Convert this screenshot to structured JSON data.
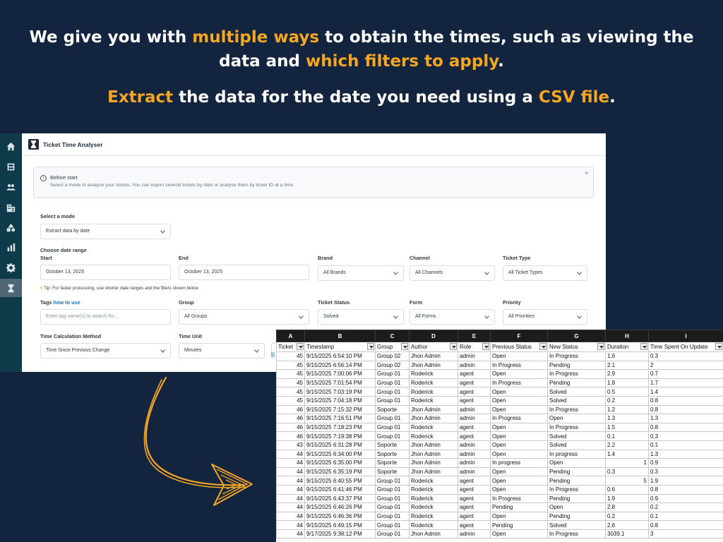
{
  "headline": {
    "line1_a": "We give you with ",
    "line1_hl": "multiple ways",
    "line1_b": " to obtain the times, such as viewing the",
    "line2_a": "data and ",
    "line2_hl": "which filters to apply",
    "line2_b": ".",
    "line3_hl": "Extract",
    "line3_a": " the data for the date you need using a ",
    "line3_hl2": "CSV file",
    "line3_b": "."
  },
  "colors": {
    "background": "#13243f",
    "accent": "#f5a623",
    "sidebar": "#0f3a4a",
    "link": "#1f73b7"
  },
  "sidebar": {
    "items": [
      {
        "icon": "home-icon"
      },
      {
        "icon": "inbox-icon"
      },
      {
        "icon": "users-icon"
      },
      {
        "icon": "building-icon"
      },
      {
        "icon": "shapes-icon"
      },
      {
        "icon": "bar-chart-icon"
      },
      {
        "icon": "gear-icon"
      },
      {
        "icon": "hourglass-icon",
        "active": true
      }
    ]
  },
  "app": {
    "title": "Ticket Time Analyser",
    "info": {
      "title": "Before start",
      "text": "Select a mode to analyse your tickets. You can export several tickets by date or analyse them by ticket ID at a time.",
      "close": "×"
    },
    "mode": {
      "label": "Select a mode",
      "value": "Extract data by date"
    },
    "date_range_label": "Choose date range",
    "start": {
      "label": "Start",
      "value": "October 13, 2025"
    },
    "end": {
      "label": "End",
      "value": "October 13, 2025"
    },
    "brand": {
      "label": "Brand",
      "value": "All Brands"
    },
    "channel": {
      "label": "Channel",
      "value": "All Channels"
    },
    "ticket_type": {
      "label": "Ticket Type",
      "value": "All Ticket Types"
    },
    "tip": "Tip: For faster processing, use shorter date ranges and the filters shown below",
    "tags": {
      "label": "Tags",
      "link": "how to use",
      "placeholder": "Enter tag name(s) to search for..."
    },
    "group": {
      "label": "Group",
      "value": "All Groups"
    },
    "ticket_status": {
      "label": "Ticket Status",
      "value": "Solved"
    },
    "form": {
      "label": "Form",
      "value": "All Forms"
    },
    "priority": {
      "label": "Priority",
      "value": "All Priorities"
    },
    "time_calc": {
      "label": "Time Calculation Method",
      "value": "Time Since Previous Change"
    },
    "time_unit": {
      "label": "Time Unit",
      "value": "Minutes"
    },
    "cut_link": "w"
  },
  "sheet": {
    "columns": [
      "A",
      "B",
      "C",
      "D",
      "E",
      "F",
      "G",
      "H",
      "I"
    ],
    "fields": [
      "Ticket",
      "Timestamp",
      "Group",
      "Author",
      "Role",
      "Previous Status",
      "New Status",
      "Duration",
      "Time Spent On Update"
    ],
    "rows": [
      [
        "45",
        "9/15/2025 6:54:10 PM",
        "Group 02",
        "Jhon Admin",
        "admin",
        "Open",
        "In Progress",
        "1.6",
        "0.3"
      ],
      [
        "45",
        "9/15/2025 6:56:14 PM",
        "Group 02",
        "Jhon Admin",
        "admin",
        "In Progress",
        "Pending",
        "2.1",
        "2"
      ],
      [
        "45",
        "9/15/2025 7:00:06 PM",
        "Group 01",
        "Roderick",
        "agent",
        "Open",
        "In Progress",
        "2.9",
        "0.7"
      ],
      [
        "45",
        "9/15/2025 7:01:54 PM",
        "Group 01",
        "Roderick",
        "agent",
        "In Progress",
        "Pending",
        "1.8",
        "1.7"
      ],
      [
        "45",
        "9/15/2025 7:03:19 PM",
        "Group 01",
        "Roderick",
        "agent",
        "Open",
        "Solved",
        "0.5",
        "1.4"
      ],
      [
        "45",
        "9/15/2025 7:04:18 PM",
        "Group 01",
        "Roderick",
        "agent",
        "Open",
        "Solved",
        "0.2",
        "0.8"
      ],
      [
        "46",
        "9/15/2025 7:15:32 PM",
        "Soporte",
        "Jhon Admin",
        "admin",
        "Open",
        "In Progress",
        "1.2",
        "0.8"
      ],
      [
        "46",
        "9/15/2025 7:16:51 PM",
        "Group 01",
        "Jhon Admin",
        "admin",
        "In Progress",
        "Open",
        "1.3",
        "1.3"
      ],
      [
        "46",
        "9/15/2025 7:18:23 PM",
        "Group 01",
        "Roderick",
        "agent",
        "Open",
        "In Progress",
        "1.5",
        "0.8"
      ],
      [
        "46",
        "9/15/2025 7:19:38 PM",
        "Group 01",
        "Roderick",
        "agent",
        "Open",
        "Solved",
        "0.1",
        "0.3"
      ],
      [
        "43",
        "9/15/2025 6:31:28 PM",
        "Soporte",
        "Jhon Admin",
        "admin",
        "Open",
        "Solved",
        "2.2",
        "0.1"
      ],
      [
        "44",
        "9/15/2025 6:34:00 PM",
        "Soporte",
        "Jhon Admin",
        "admin",
        "Open",
        "In progress",
        "1.4",
        "1.3"
      ],
      [
        "44",
        "9/15/2025 6:35:00 PM",
        "Soporte",
        "Jhon Admin",
        "admin",
        "In progress",
        "Open",
        "1",
        "0.9"
      ],
      [
        "44",
        "9/15/2025 6:35:19 PM",
        "Soporte",
        "Jhon Admin",
        "admin",
        "Open",
        "Pending",
        "0.3",
        "0.3"
      ],
      [
        "44",
        "9/15/2025 6:40:55 PM",
        "Group 01",
        "Roderick",
        "agent",
        "Open",
        "Pending",
        "5",
        "1.9"
      ],
      [
        "44",
        "9/15/2025 6:41:46 PM",
        "Group 01",
        "Roderick",
        "agent",
        "Open",
        "In Progress",
        "0.6",
        "0.8"
      ],
      [
        "44",
        "9/15/2025 6:43:37 PM",
        "Group 01",
        "Roderick",
        "agent",
        "In Progress",
        "Pending",
        "1.9",
        "0.9"
      ],
      [
        "44",
        "9/15/2025 6:46:26 PM",
        "Group 01",
        "Roderick",
        "agent",
        "Pending",
        "Open",
        "2.8",
        "0.2"
      ],
      [
        "44",
        "9/15/2025 6:46:36 PM",
        "Group 01",
        "Roderick",
        "agent",
        "Open",
        "Pending",
        "0.2",
        "0.1"
      ],
      [
        "44",
        "9/15/2025 6:49:15 PM",
        "Group 01",
        "Roderick",
        "agent",
        "Pending",
        "Solved",
        "2.6",
        "0.8"
      ],
      [
        "44",
        "9/17/2025 9:38:12 PM",
        "Group 01",
        "Jhon Admin",
        "admin",
        "Open",
        "In Progress",
        "3039.1",
        "3"
      ]
    ],
    "right_aligned_duration_rows": [
      12,
      14
    ]
  }
}
